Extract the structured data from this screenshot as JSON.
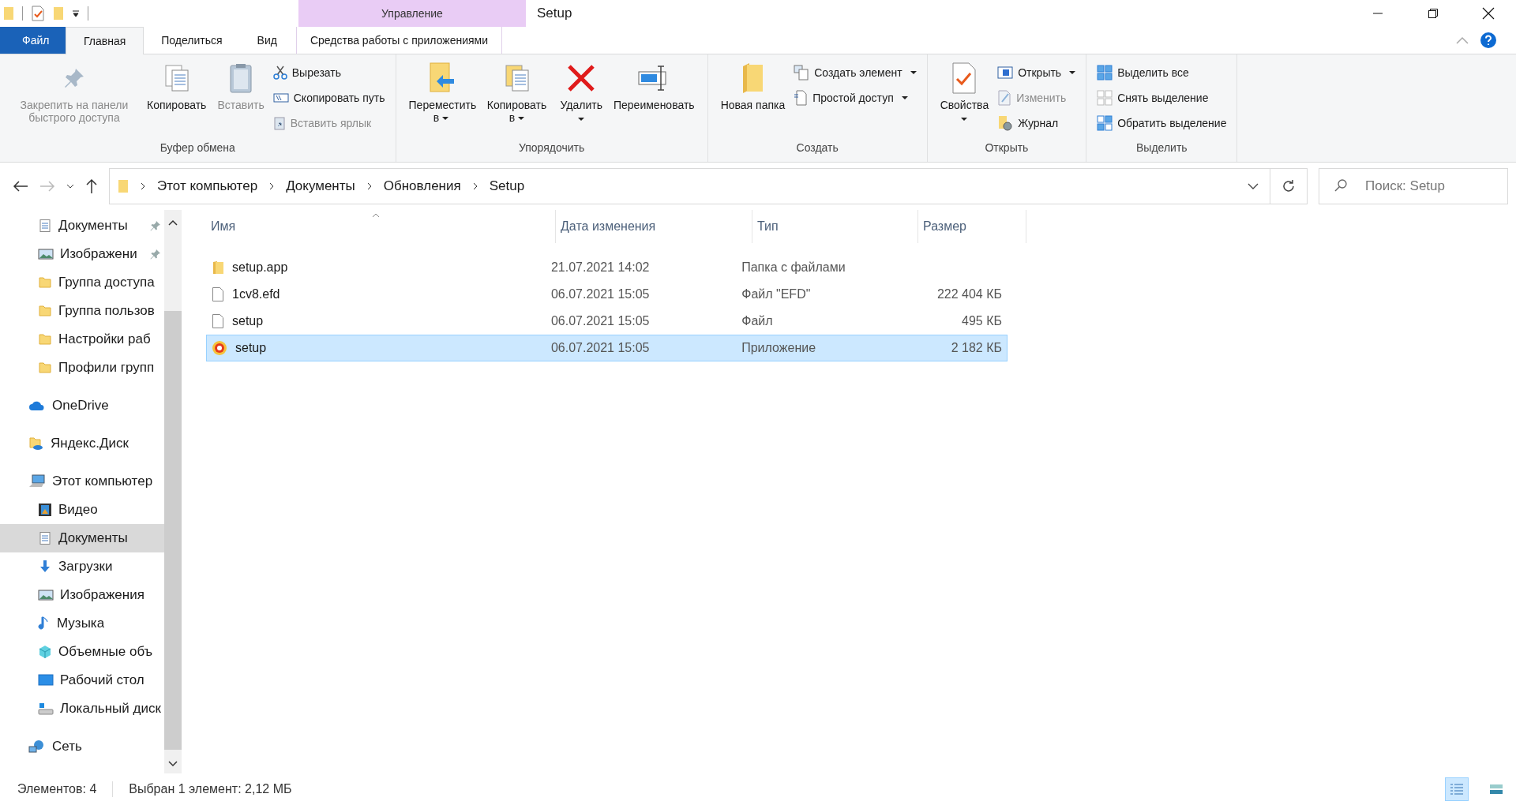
{
  "window": {
    "title": "Setup",
    "context_group": "Управление"
  },
  "ribbon_tabs": [
    {
      "label": "Файл",
      "kind": "file",
      "selected": false
    },
    {
      "label": "Главная",
      "kind": "tab",
      "selected": true
    },
    {
      "label": "Поделиться",
      "kind": "tab",
      "selected": false
    },
    {
      "label": "Вид",
      "kind": "tab",
      "selected": false
    },
    {
      "label": "Средства работы с приложениями",
      "kind": "context",
      "selected": false
    }
  ],
  "ribbon_groups": [
    {
      "label": "Буфер обмена",
      "items": [
        {
          "label": "Закрепить на панели быстрого доступа",
          "kind": "large",
          "disabled": true,
          "dropdown": false
        },
        {
          "label": "Копировать",
          "kind": "large",
          "disabled": false,
          "dropdown": false
        },
        {
          "label": "Вставить",
          "kind": "large",
          "disabled": true,
          "dropdown": false
        },
        {
          "label": "Вырезать",
          "kind": "small",
          "disabled": false,
          "dropdown": false
        },
        {
          "label": "Скопировать путь",
          "kind": "small",
          "disabled": false,
          "dropdown": false
        },
        {
          "label": "Вставить ярлык",
          "kind": "small",
          "disabled": true,
          "dropdown": false
        }
      ]
    },
    {
      "label": "Упорядочить",
      "items": [
        {
          "label": "Переместить в",
          "kind": "large",
          "disabled": false,
          "dropdown": true
        },
        {
          "label": "Копировать в",
          "kind": "large",
          "disabled": false,
          "dropdown": true
        },
        {
          "label": "Удалить",
          "kind": "large",
          "disabled": false,
          "dropdown": true
        },
        {
          "label": "Переименовать",
          "kind": "large",
          "disabled": false,
          "dropdown": false
        }
      ]
    },
    {
      "label": "Создать",
      "items": [
        {
          "label": "Новая папка",
          "kind": "large",
          "disabled": false,
          "dropdown": false
        },
        {
          "label": "Создать элемент",
          "kind": "small",
          "disabled": false,
          "dropdown": true
        },
        {
          "label": "Простой доступ",
          "kind": "small",
          "disabled": false,
          "dropdown": true
        }
      ]
    },
    {
      "label": "Открыть",
      "items": [
        {
          "label": "Свойства",
          "kind": "large",
          "disabled": false,
          "dropdown": true
        },
        {
          "label": "Открыть",
          "kind": "small",
          "disabled": false,
          "dropdown": true
        },
        {
          "label": "Изменить",
          "kind": "small",
          "disabled": true,
          "dropdown": false
        },
        {
          "label": "Журнал",
          "kind": "small",
          "disabled": false,
          "dropdown": false
        }
      ]
    },
    {
      "label": "Выделить",
      "items": [
        {
          "label": "Выделить все",
          "kind": "small",
          "disabled": false,
          "dropdown": false
        },
        {
          "label": "Снять выделение",
          "kind": "small",
          "disabled": false,
          "dropdown": false
        },
        {
          "label": "Обратить выделение",
          "kind": "small",
          "disabled": false,
          "dropdown": false
        }
      ]
    }
  ],
  "address": {
    "path": [
      "Этот компьютер",
      "Документы",
      "Обновления",
      "Setup"
    ]
  },
  "search": {
    "placeholder": "Поиск: Setup"
  },
  "navigation": [
    {
      "label": "Документы",
      "kind": "documents",
      "pinned": true,
      "selected": false
    },
    {
      "label": "Изображени",
      "kind": "pictures",
      "pinned": true,
      "selected": false
    },
    {
      "label": "Группа доступа",
      "kind": "folder",
      "pinned": false,
      "selected": false
    },
    {
      "label": "Группа пользов",
      "kind": "folder",
      "pinned": false,
      "selected": false
    },
    {
      "label": "Настройки раб",
      "kind": "folder",
      "pinned": false,
      "selected": false
    },
    {
      "label": "Профили групп",
      "kind": "folder",
      "pinned": false,
      "selected": false
    },
    {
      "label": "OneDrive",
      "kind": "onedrive",
      "pinned": false,
      "selected": false
    },
    {
      "label": "Яндекс.Диск",
      "kind": "yadisk",
      "pinned": false,
      "selected": false
    },
    {
      "label": "Этот компьютер",
      "kind": "computer",
      "pinned": false,
      "selected": false,
      "children": [
        {
          "label": "Видео",
          "kind": "video",
          "pinned": false,
          "selected": false
        },
        {
          "label": "Документы",
          "kind": "documents",
          "pinned": false,
          "selected": true
        },
        {
          "label": "Загрузки",
          "kind": "downloads",
          "pinned": false,
          "selected": false
        },
        {
          "label": "Изображения",
          "kind": "pictures",
          "pinned": false,
          "selected": false
        },
        {
          "label": "Музыка",
          "kind": "music",
          "pinned": false,
          "selected": false
        },
        {
          "label": "Объемные объ",
          "kind": "objects",
          "pinned": false,
          "selected": false
        },
        {
          "label": "Рабочий стол",
          "kind": "desktop",
          "pinned": false,
          "selected": false
        },
        {
          "label": "Локальный диск",
          "kind": "disk",
          "pinned": false,
          "selected": false
        }
      ]
    },
    {
      "label": "Сеть",
      "kind": "network",
      "pinned": false,
      "selected": false
    }
  ],
  "table": {
    "columns": [
      "Имя",
      "Дата изменения",
      "Тип",
      "Размер"
    ],
    "rows": [
      {
        "name": "setup.app",
        "kind": "folder",
        "date": "21.07.2021 14:02",
        "type": "Папка с файлами",
        "size": "",
        "selected": false
      },
      {
        "name": "1cv8.efd",
        "kind": "file",
        "date": "06.07.2021 15:05",
        "type": "Файл \"EFD\"",
        "size": "222 404 КБ",
        "selected": false
      },
      {
        "name": "setup",
        "kind": "file",
        "date": "06.07.2021 15:05",
        "type": "Файл",
        "size": "495 КБ",
        "selected": false
      },
      {
        "name": "setup",
        "kind": "app",
        "date": "06.07.2021 15:05",
        "type": "Приложение",
        "size": "2 182 КБ",
        "selected": true
      }
    ]
  },
  "status_bar": {
    "items_count": "Элементов: 4",
    "selection": "Выбран 1 элемент: 2,12 МБ"
  },
  "view_buttons": [
    {
      "kind": "details",
      "selected": true
    },
    {
      "kind": "tiles",
      "selected": false
    }
  ]
}
